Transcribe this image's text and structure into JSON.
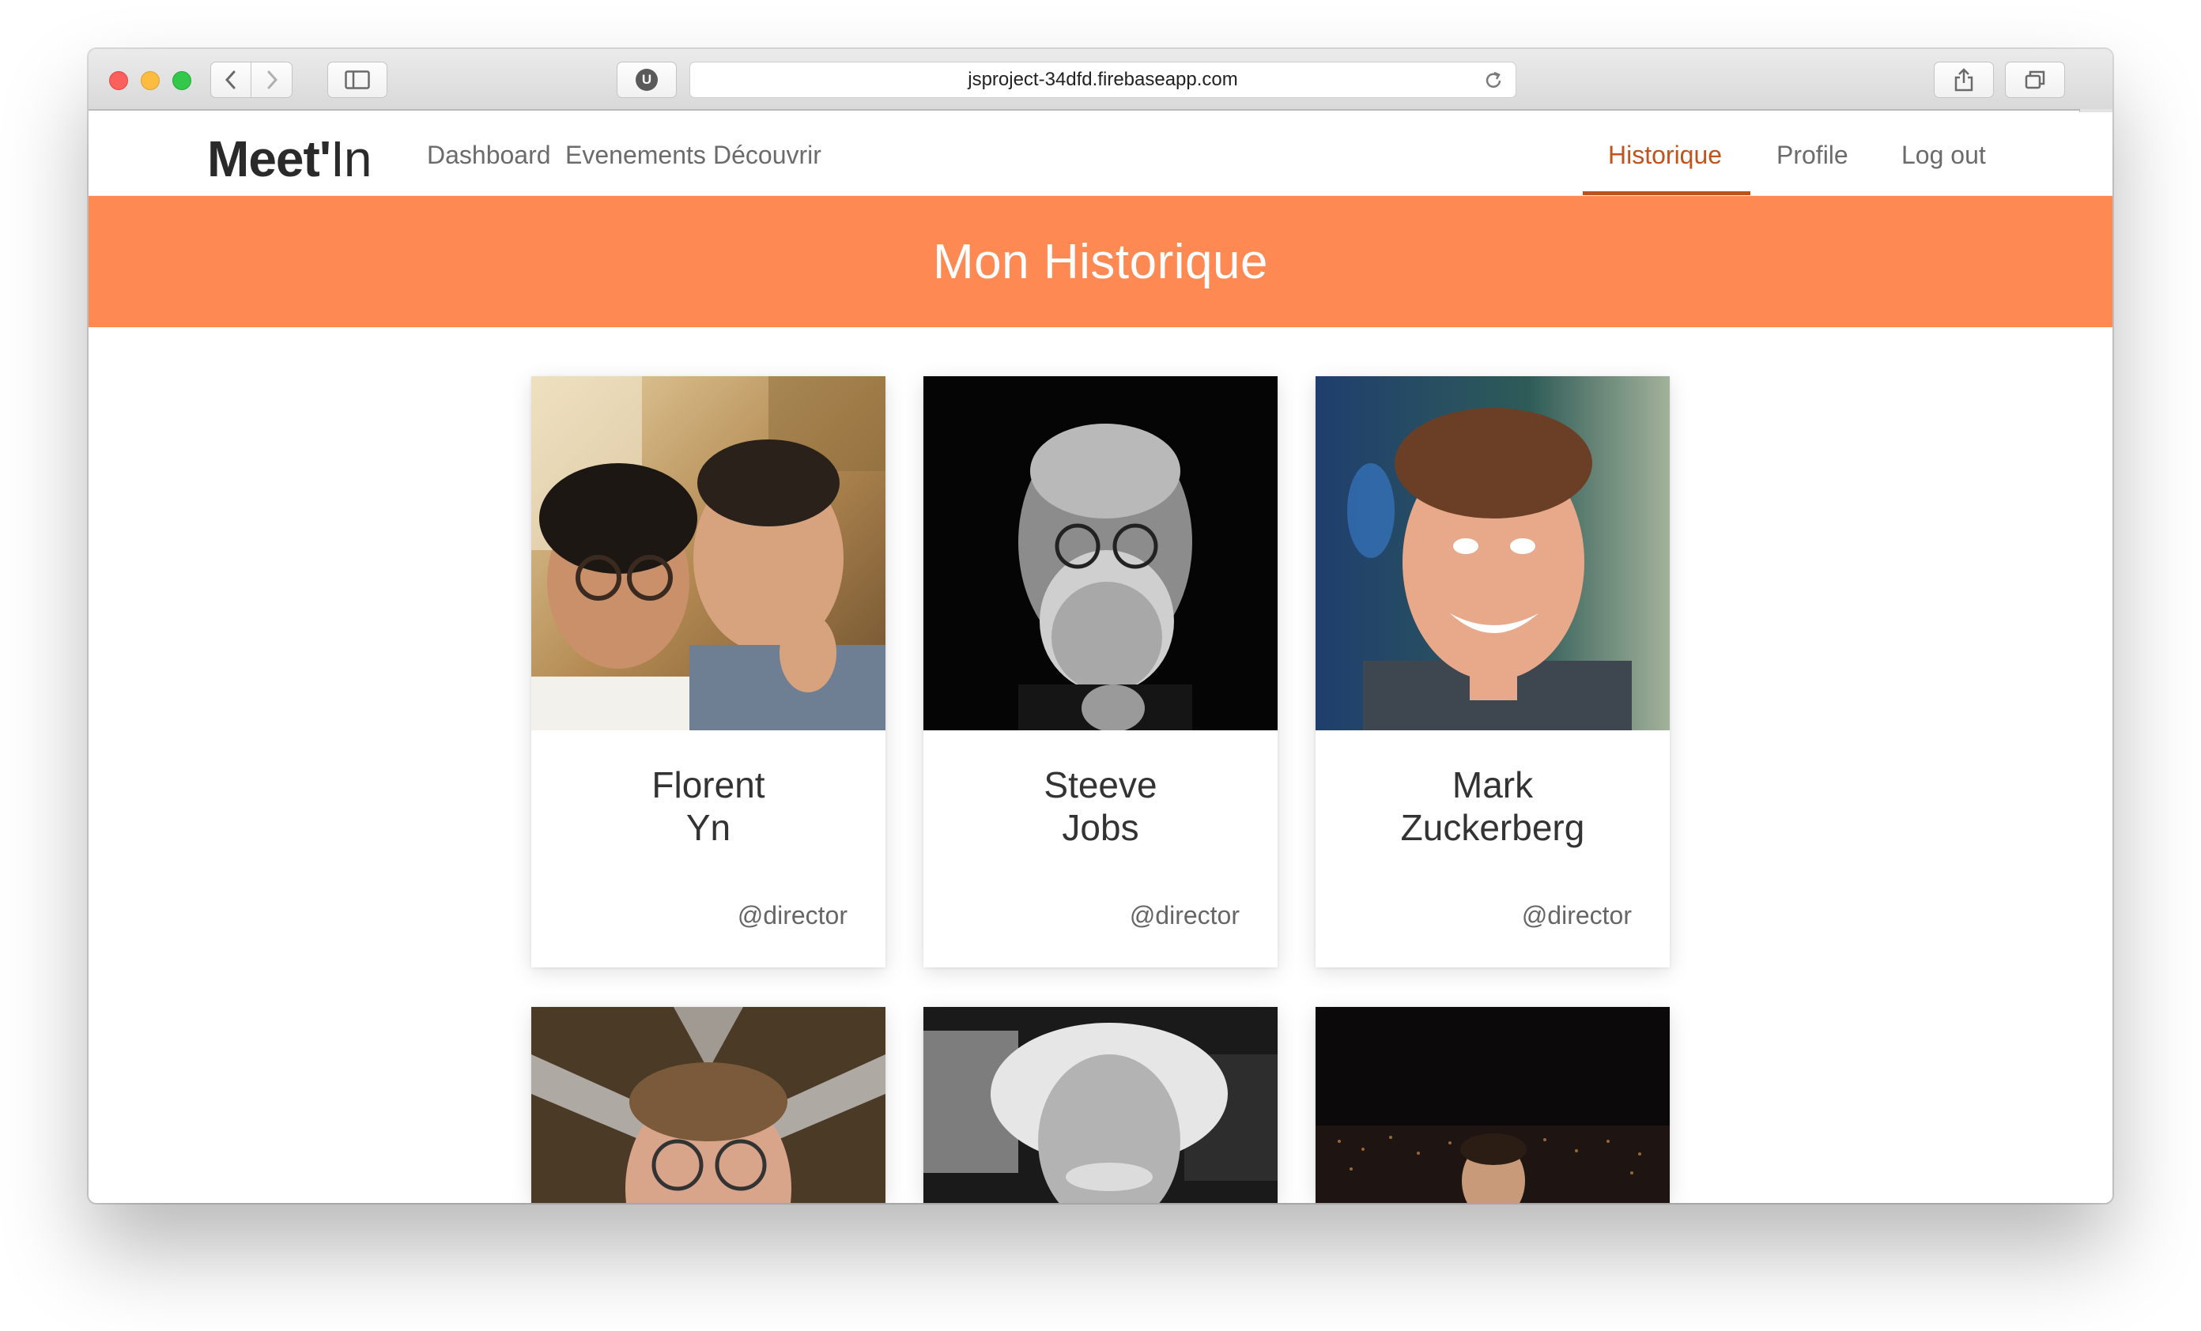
{
  "browser": {
    "url": "jsproject-34dfd.firebaseapp.com",
    "extension_badge": "U",
    "icons": [
      "back-icon",
      "forward-icon",
      "sidebar-icon",
      "reload-icon",
      "share-icon",
      "tabs-icon",
      "plus-icon"
    ]
  },
  "nav": {
    "brand_bold": "Meet'",
    "brand_light": "In",
    "links": [
      "Dashboard",
      "Evenements",
      "Découvrir"
    ],
    "right_links": [
      "Historique",
      "Profile",
      "Log out"
    ],
    "active": "Historique",
    "accent_color": "#c0541c"
  },
  "hero": {
    "title": "Mon Historique",
    "color": "#ff8953"
  },
  "cards": [
    {
      "first": "Florent",
      "last": "Yn",
      "role": "@director",
      "photo": "two-men-photo"
    },
    {
      "first": "Steeve",
      "last": "Jobs",
      "role": "@director",
      "photo": "bw-portrait-photo"
    },
    {
      "first": "Mark",
      "last": "Zuckerberg",
      "role": "@director",
      "photo": "smiling-man-photo"
    },
    {
      "photo": "glasses-man-photo"
    },
    {
      "photo": "einstein-photo"
    },
    {
      "photo": "night-city-photo"
    }
  ]
}
